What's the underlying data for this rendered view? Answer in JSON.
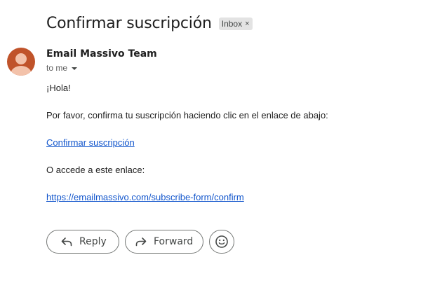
{
  "email": {
    "subject": "Confirmar suscripción",
    "label": "Inbox",
    "label_close_icon": "×",
    "sender_name": "Email Massivo Team",
    "recipient": "to me",
    "body": {
      "greeting": "¡Hola!",
      "instruction": "Por favor, confirma tu suscripción haciendo clic en el enlace de abajo:",
      "confirm_link": "Confirmar suscripción",
      "alt_text": "O accede a este enlace:",
      "url_link": "https://emailmassivo.com/subscribe-form/confirm"
    }
  },
  "actions": {
    "reply_label": "Reply",
    "forward_label": "Forward"
  },
  "icons": {
    "reply": "reply-icon",
    "forward": "forward-icon",
    "emoji": "emoji-icon"
  },
  "colors": {
    "avatar_bg": "#c0532a",
    "link": "#1155cc",
    "label_chip_bg": "#e3e3e3"
  }
}
